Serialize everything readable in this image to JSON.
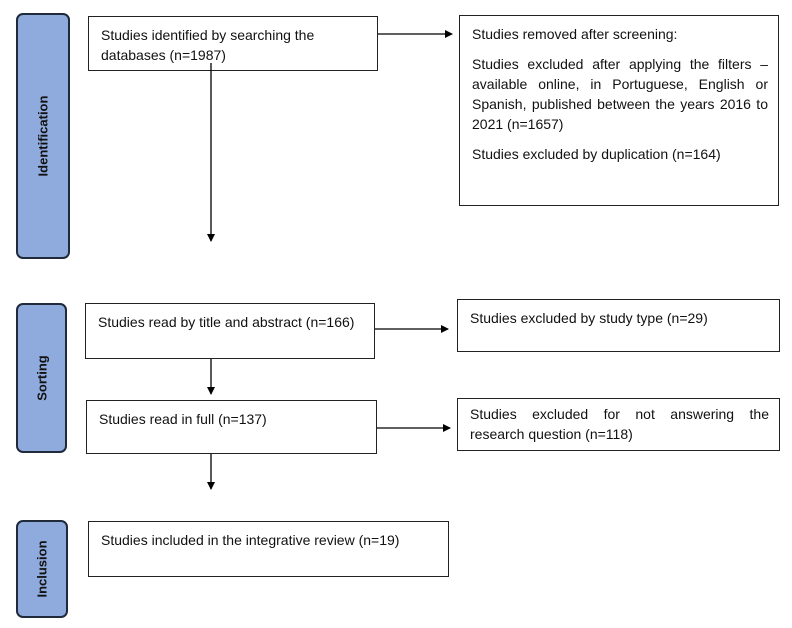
{
  "phases": {
    "identification": "Identification",
    "sorting": "Sorting",
    "inclusion": "Inclusion"
  },
  "boxes": {
    "identified": "Studies identified by searching the databases (n=1987)",
    "removed_title": "Studies removed after screening:",
    "removed_filters": "Studies excluded after applying the filters – available online, in Portuguese, English or Spanish, published between the years 2016 to 2021 (n=1657)",
    "removed_duplication": "Studies excluded by duplication (n=164)",
    "read_title_abstract": "Studies read by title and abstract (n=166)",
    "excluded_type": "Studies excluded by study type (n=29)",
    "read_full": "Studies read in full (n=137)",
    "excluded_question": "Studies excluded for not answering the research question (n=118)",
    "included": "Studies included in the integrative review (n=19)"
  },
  "colors": {
    "phase_fill": "#8faadc",
    "line": "#000000"
  }
}
